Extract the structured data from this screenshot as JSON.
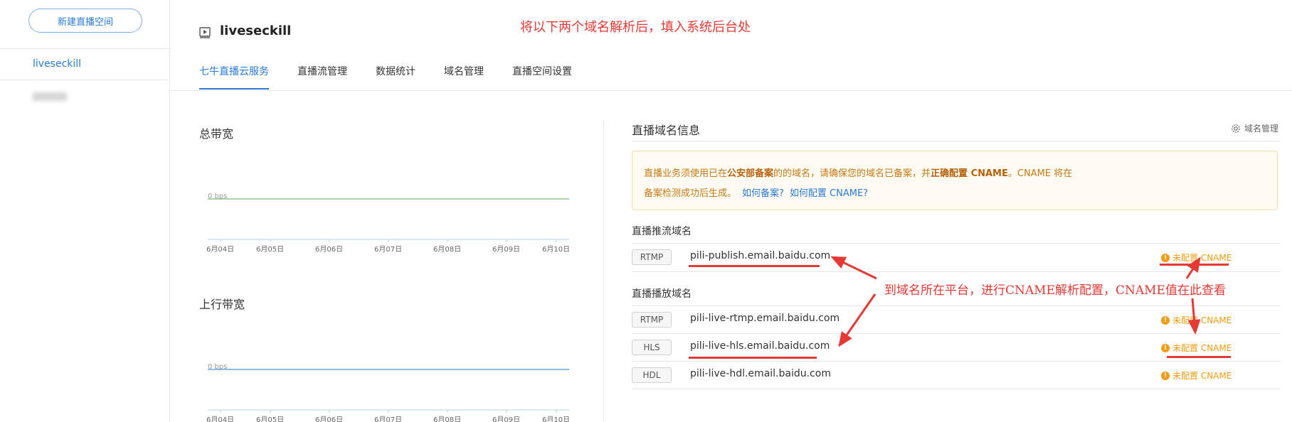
{
  "sidebar": {
    "new_space_button": "新建直播空间",
    "items": [
      {
        "label": "liveseckill",
        "active": true
      },
      {
        "label": "",
        "blurred": true
      }
    ]
  },
  "header": {
    "title": "liveseckill",
    "icon": "video-play-icon"
  },
  "annotations": {
    "top": "将以下两个域名解析后，填入系统后台处",
    "middle": "到域名所在平台，进行CNAME解析配置，CNAME值在此查看"
  },
  "tabs": [
    {
      "label": "七牛直播云服务",
      "active": true
    },
    {
      "label": "直播流管理"
    },
    {
      "label": "数据统计"
    },
    {
      "label": "域名管理"
    },
    {
      "label": "直播空间设置"
    }
  ],
  "charts": [
    {
      "title": "总带宽",
      "zero_label": "0 bps",
      "line_color": "#4caf50",
      "x_labels": [
        "6月04日",
        "6月05日",
        "6月06日",
        "6月07日",
        "6月08日",
        "6月09日",
        "6月10日"
      ]
    },
    {
      "title": "上行带宽",
      "zero_label": "0 bps",
      "line_color": "#2a7ad6",
      "x_labels": [
        "6月04日",
        "6月05日",
        "6月06日",
        "6月07日",
        "6月08日",
        "6月09日",
        "6月10日"
      ]
    }
  ],
  "chart_data": [
    {
      "type": "line",
      "title": "总带宽",
      "categories": [
        "6月04日",
        "6月05日",
        "6月06日",
        "6月07日",
        "6月08日",
        "6月09日",
        "6月10日"
      ],
      "values": [
        0,
        0,
        0,
        0,
        0,
        0,
        0
      ],
      "ylabel": "",
      "tick_label": "0 bps"
    },
    {
      "type": "line",
      "title": "上行带宽",
      "categories": [
        "6月04日",
        "6月05日",
        "6月06日",
        "6月07日",
        "6月08日",
        "6月09日",
        "6月10日"
      ],
      "values": [
        0,
        0,
        0,
        0,
        0,
        0,
        0
      ],
      "ylabel": "",
      "tick_label": "0 bps"
    }
  ],
  "domain_info": {
    "title": "直播域名信息",
    "manage_link": "域名管理",
    "notice": {
      "line1_prefix": "直播业务须使用已在",
      "line1_bold1": "公安部备案",
      "line1_mid": "的的域名，请确保您的域名已备案，并",
      "line1_bold2": "正确配置 CNAME",
      "line1_suffix": "。CNAME 将在",
      "line2_text": "备案检测成功后生成。",
      "link1": "如何备案?",
      "link2": "如何配置 CNAME?"
    },
    "push_title": "直播推流域名",
    "play_title": "直播播放域名",
    "cname_status": "未配置 CNAME",
    "push_domains": [
      {
        "protocol": "RTMP",
        "domain": "pili-publish.email.baidu.com"
      }
    ],
    "play_domains": [
      {
        "protocol": "RTMP",
        "domain": "pili-live-rtmp.email.baidu.com"
      },
      {
        "protocol": "HLS",
        "domain": "pili-live-hls.email.baidu.com"
      },
      {
        "protocol": "HDL",
        "domain": "pili-live-hdl.email.baidu.com"
      }
    ]
  }
}
